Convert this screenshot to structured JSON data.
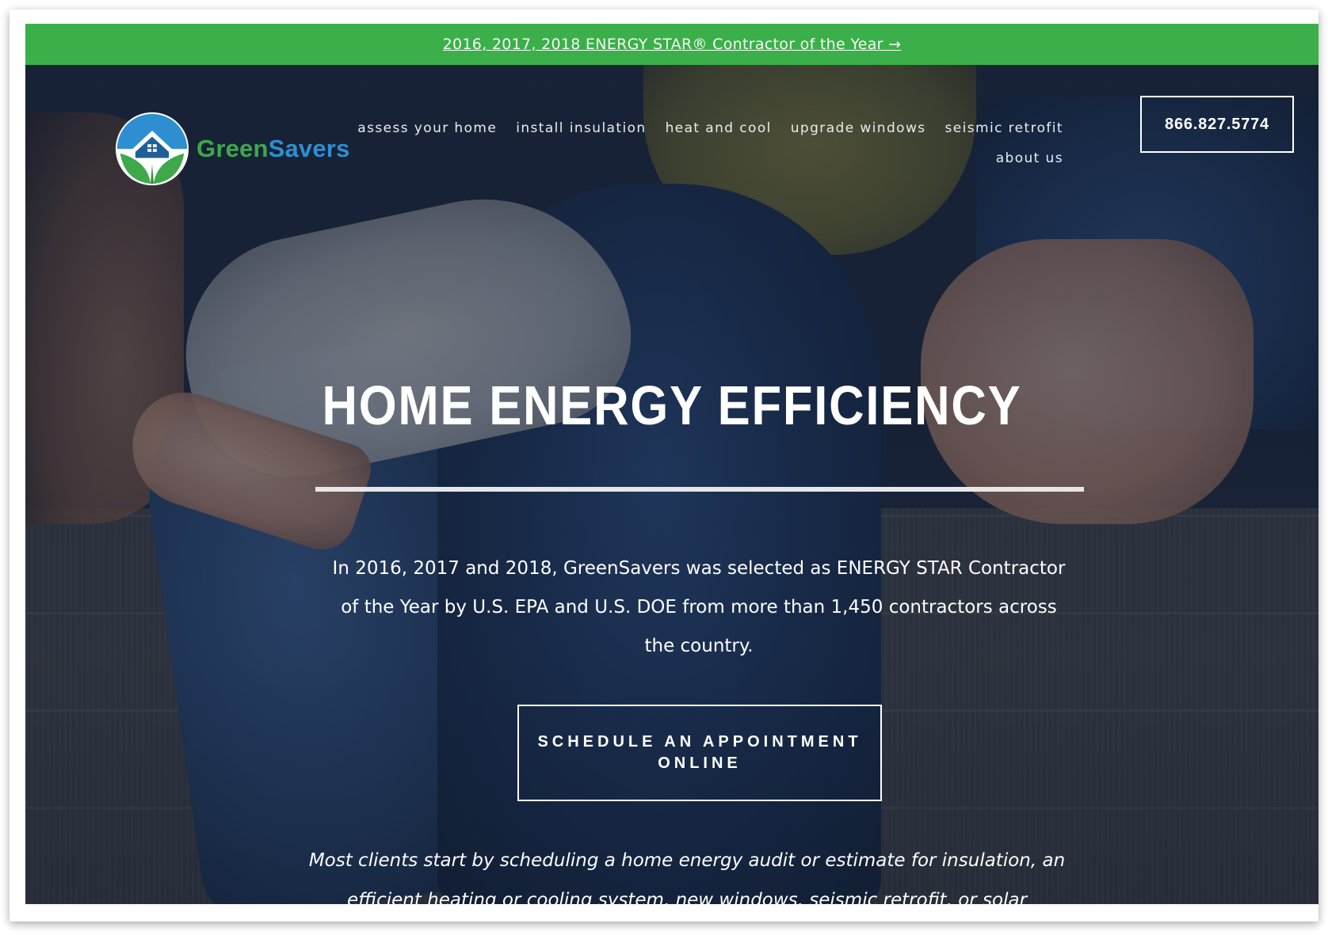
{
  "announcement": {
    "link_text": "2016, 2017, 2018 ENERGY STAR® Contractor of the Year →"
  },
  "brand": {
    "name_part1": "Green",
    "name_part2": "Savers",
    "colors": {
      "green": "#3ea84a",
      "blue": "#2e8fd0",
      "bar_green": "#3bb04a"
    }
  },
  "nav": {
    "items": [
      {
        "label": "assess your home"
      },
      {
        "label": "install insulation"
      },
      {
        "label": "heat and cool"
      },
      {
        "label": "upgrade windows"
      },
      {
        "label": "seismic retrofit"
      },
      {
        "label": "about us"
      }
    ],
    "phone": "866.827.5774"
  },
  "hero": {
    "title": "HOME ENERGY EFFICIENCY",
    "description": "In 2016, 2017 and 2018, GreenSavers was selected as ENERGY STAR Contractor of the Year by U.S. EPA and U.S. DOE from more than 1,450 contractors across the country.",
    "cta_label": "SCHEDULE AN APPOINTMENT ONLINE",
    "intro": "Most clients start by scheduling a home energy audit or estimate for insulation, an efficient heating or cooling system, new windows, seismic retrofit, or solar"
  }
}
